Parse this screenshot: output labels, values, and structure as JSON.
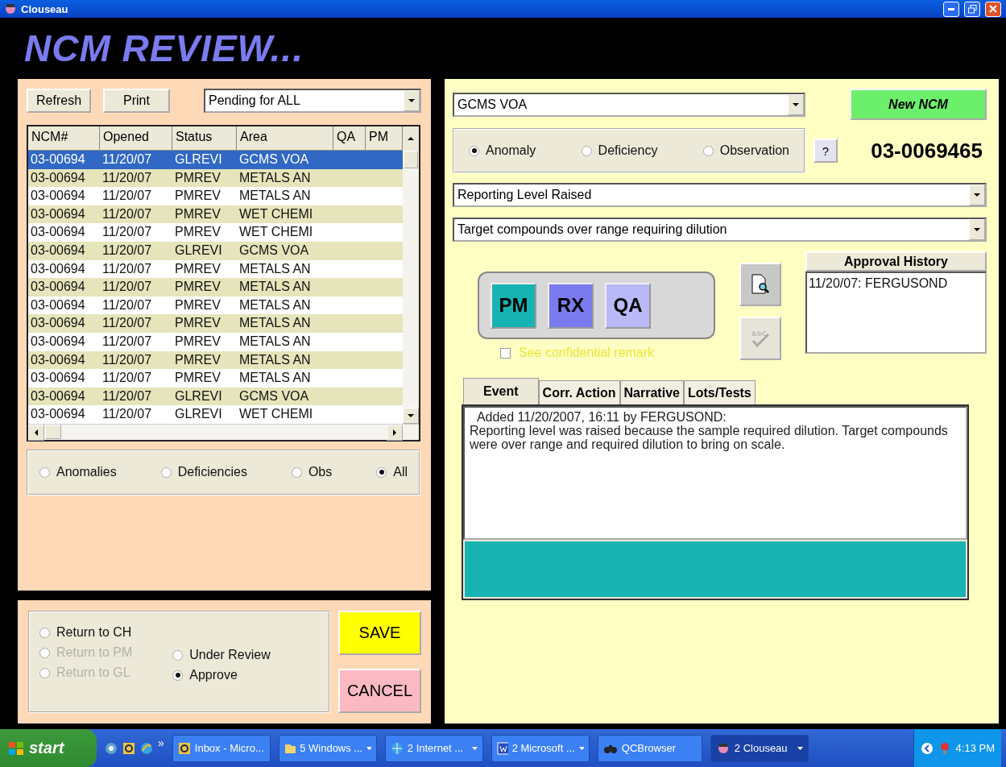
{
  "window": {
    "title": "Clouseau"
  },
  "heading": "NCM REVIEW...",
  "left": {
    "buttons": [
      "Refresh",
      "Print"
    ],
    "filter_combo": {
      "value": "Pending for ALL"
    },
    "table": {
      "columns": [
        "NCM#",
        "Opened",
        "Status",
        "Area",
        "QA",
        "PM"
      ],
      "rows": [
        {
          "cells": [
            "03-00694",
            "11/20/07",
            "GLREVI",
            "GCMS VOA"
          ],
          "selected": true
        },
        {
          "cells": [
            "03-00694",
            "11/20/07",
            "PMREV",
            "METALS AN"
          ],
          "selected": false
        },
        {
          "cells": [
            "03-00694",
            "11/20/07",
            "PMREV",
            "METALS AN"
          ],
          "selected": false
        },
        {
          "cells": [
            "03-00694",
            "11/20/07",
            "PMREV",
            "WET CHEMI"
          ],
          "selected": false
        },
        {
          "cells": [
            "03-00694",
            "11/20/07",
            "PMREV",
            "WET CHEMI"
          ],
          "selected": false
        },
        {
          "cells": [
            "03-00694",
            "11/20/07",
            "GLREVI",
            "GCMS VOA"
          ],
          "selected": false
        },
        {
          "cells": [
            "03-00694",
            "11/20/07",
            "PMREV",
            "METALS AN"
          ],
          "selected": false
        },
        {
          "cells": [
            "03-00694",
            "11/20/07",
            "PMREV",
            "METALS AN"
          ],
          "selected": false
        },
        {
          "cells": [
            "03-00694",
            "11/20/07",
            "PMREV",
            "METALS AN"
          ],
          "selected": false
        },
        {
          "cells": [
            "03-00694",
            "11/20/07",
            "PMREV",
            "METALS AN"
          ],
          "selected": false
        },
        {
          "cells": [
            "03-00694",
            "11/20/07",
            "PMREV",
            "METALS AN"
          ],
          "selected": false
        },
        {
          "cells": [
            "03-00694",
            "11/20/07",
            "PMREV",
            "METALS AN"
          ],
          "selected": false
        },
        {
          "cells": [
            "03-00694",
            "11/20/07",
            "PMREV",
            "METALS AN"
          ],
          "selected": false
        },
        {
          "cells": [
            "03-00694",
            "11/20/07",
            "GLREVI",
            "GCMS VOA"
          ],
          "selected": false
        },
        {
          "cells": [
            "03-00694",
            "11/20/07",
            "GLREVI",
            "WET CHEMI"
          ],
          "selected": false
        }
      ]
    },
    "type_filter": [
      {
        "label": "Anomalies",
        "selected": false
      },
      {
        "label": "Deficiencies",
        "selected": false
      },
      {
        "label": "Obs",
        "selected": false
      },
      {
        "label": "All",
        "selected": true
      }
    ]
  },
  "decision": {
    "columns": [
      [
        {
          "label": "Return to CH",
          "selected": false,
          "disabled": false
        },
        {
          "label": "Return to PM",
          "selected": false,
          "disabled": true
        },
        {
          "label": "Return to GL",
          "selected": false,
          "disabled": true
        }
      ],
      [
        {
          "label": "Under Review",
          "selected": false,
          "disabled": false
        },
        {
          "label": "Approve",
          "selected": true,
          "disabled": false
        }
      ]
    ],
    "save": "SAVE",
    "cancel": "CANCEL"
  },
  "right": {
    "area_combo": {
      "value": "GCMS VOA"
    },
    "new_button": "New NCM",
    "ncm_type": [
      {
        "label": "Anomaly",
        "selected": true
      },
      {
        "label": "Deficiency",
        "selected": false
      },
      {
        "label": "Observation",
        "selected": false
      }
    ],
    "help_button": "?",
    "ncm_number": "03-0069465",
    "reason_combo": {
      "value": "Reporting Level Raised"
    },
    "detail_combo": {
      "value": "Target compounds over range requiring dilution"
    },
    "roles": [
      {
        "label": "PM",
        "color": "#17b3b3"
      },
      {
        "label": "RX",
        "color": "#7b7bf0"
      },
      {
        "label": "QA",
        "color": "#b9b9f7"
      }
    ],
    "tool_buttons": [
      {
        "kind": "preview",
        "disabled": false
      },
      {
        "kind": "spellcheck",
        "disabled": true
      }
    ],
    "approval_history": {
      "title": "Approval History",
      "entries": [
        "11/20/07: FERGUSOND"
      ]
    },
    "confidential": {
      "label": "See confidential remark",
      "checked": false
    },
    "tabs": [
      {
        "label": "Event",
        "selected": true
      },
      {
        "label": "Corr. Action",
        "selected": false
      },
      {
        "label": "Narrative",
        "selected": false
      },
      {
        "label": "Lots/Tests",
        "selected": false
      }
    ],
    "event": {
      "header": "Added 11/20/2007, 16:11 by FERGUSOND:",
      "body": "Reporting level was raised because the sample required dilution. Target compounds were over range and required dilution to bring on scale."
    }
  },
  "taskbar": {
    "start": "start",
    "chevron": "»",
    "tasks": [
      {
        "kind": "mail",
        "label": "Inbox - Micro...",
        "selected": false,
        "grouped": false
      },
      {
        "kind": "folder",
        "label": "5 Windows ...",
        "selected": false,
        "grouped": true
      },
      {
        "kind": "browser",
        "label": "2 Internet ...",
        "selected": false,
        "grouped": true
      },
      {
        "kind": "word",
        "label": "2 Microsoft ...",
        "selected": false,
        "grouped": true
      },
      {
        "kind": "binoculars",
        "label": "QCBrowser",
        "selected": false,
        "grouped": false
      },
      {
        "kind": "app",
        "label": "2 Clouseau",
        "selected": true,
        "grouped": true
      }
    ],
    "clock": "4:13 PM"
  }
}
